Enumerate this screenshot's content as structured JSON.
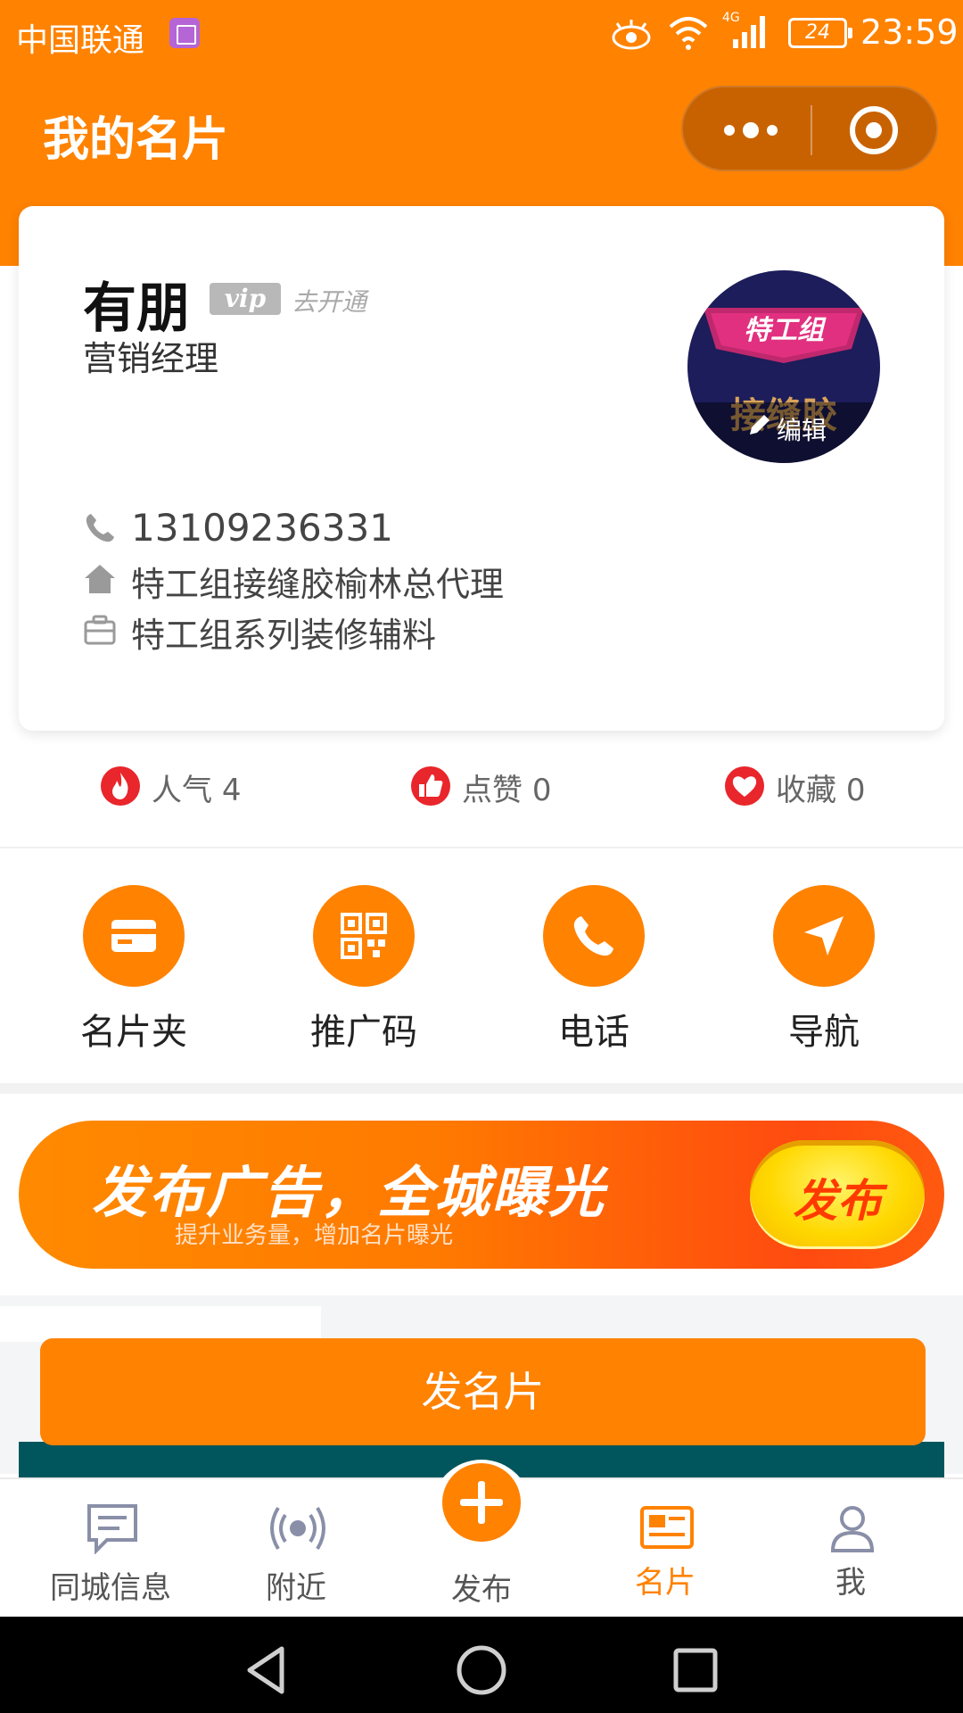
{
  "status_bar": {
    "carrier": "中国联通",
    "network": "4G",
    "battery": "24",
    "time": "23:59"
  },
  "header": {
    "title": "我的名片"
  },
  "card": {
    "name": "有朋",
    "vip_badge": "vip",
    "vip_action": "去开通",
    "job_title": "营销经理",
    "avatar": {
      "logo_text": "特工组",
      "product_text": "接缝胶",
      "edit_label": "编辑"
    },
    "phone": "13109236331",
    "company": "特工组接缝胶榆林总代理",
    "business": "特工组系列装修辅料"
  },
  "stats": [
    {
      "label": "人气",
      "value": "4"
    },
    {
      "label": "点赞",
      "value": "0"
    },
    {
      "label": "收藏",
      "value": "0"
    }
  ],
  "actions": [
    {
      "label": "名片夹",
      "icon": "card-holder-icon"
    },
    {
      "label": "推广码",
      "icon": "qr-code-icon"
    },
    {
      "label": "电话",
      "icon": "phone-icon"
    },
    {
      "label": "导航",
      "icon": "navigation-icon"
    }
  ],
  "banner": {
    "title": "发布广告，全城曝光",
    "subtitle": "提升业务量，增加名片曝光",
    "button": "发布"
  },
  "send_card_button": "发名片",
  "tabbar": [
    {
      "label": "同城信息",
      "icon": "message-icon"
    },
    {
      "label": "附近",
      "icon": "nearby-icon"
    },
    {
      "label": "发布",
      "icon": "plus-icon"
    },
    {
      "label": "名片",
      "icon": "card-icon",
      "active": true
    },
    {
      "label": "我",
      "icon": "user-icon"
    }
  ],
  "colors": {
    "primary": "#ff8200",
    "stat_red": "#e8262b"
  }
}
